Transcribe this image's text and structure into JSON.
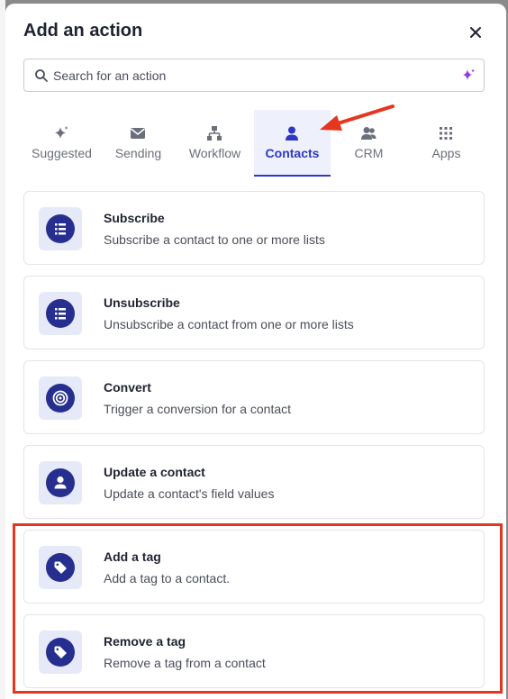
{
  "modal": {
    "title": "Add an action"
  },
  "search": {
    "placeholder": "Search for an action",
    "value": ""
  },
  "tabs": [
    {
      "label": "Suggested",
      "icon": "sparkle-icon",
      "active": false
    },
    {
      "label": "Sending",
      "icon": "envelope-icon",
      "active": false
    },
    {
      "label": "Workflow",
      "icon": "workflow-icon",
      "active": false
    },
    {
      "label": "Contacts",
      "icon": "person-icon",
      "active": true
    },
    {
      "label": "CRM",
      "icon": "people-icon",
      "active": false
    },
    {
      "label": "Apps",
      "icon": "grid-icon",
      "active": false
    }
  ],
  "actions": [
    {
      "title": "Subscribe",
      "description": "Subscribe a contact to one or more lists",
      "icon": "list-icon"
    },
    {
      "title": "Unsubscribe",
      "description": "Unsubscribe a contact from one or more lists",
      "icon": "list-icon"
    },
    {
      "title": "Convert",
      "description": "Trigger a conversion for a contact",
      "icon": "target-icon"
    },
    {
      "title": "Update a contact",
      "description": "Update a contact's field values",
      "icon": "person-icon"
    },
    {
      "title": "Add a tag",
      "description": "Add a tag to a contact.",
      "icon": "tag-icon"
    },
    {
      "title": "Remove a tag",
      "description": "Remove a tag from a contact",
      "icon": "tag-icon"
    }
  ],
  "colors": {
    "accent": "#2d38c8",
    "icon_bg": "#e6e9f8",
    "icon_circle": "#262f8f",
    "annotation": "#e5361f"
  }
}
